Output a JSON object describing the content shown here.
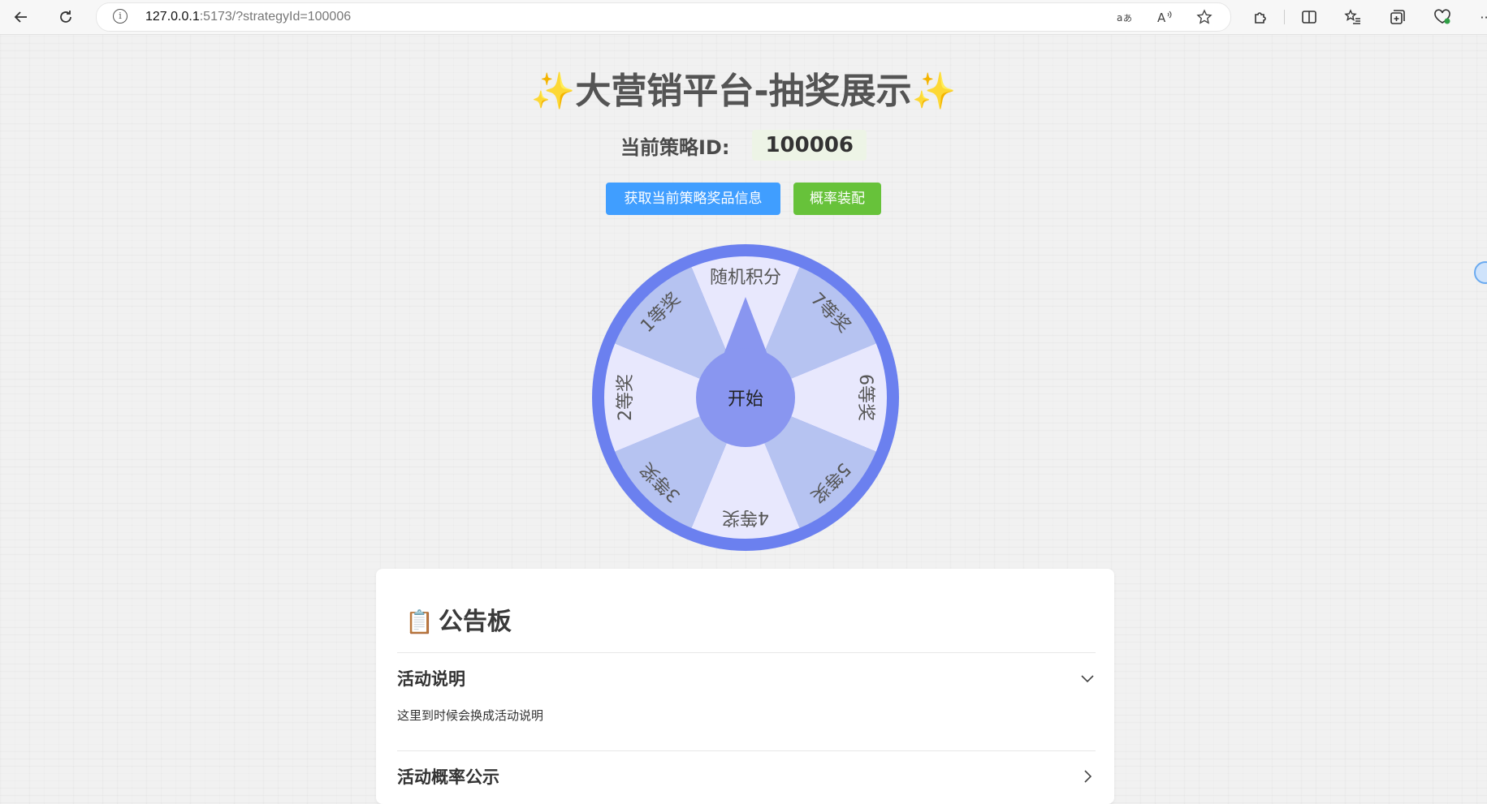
{
  "browser": {
    "url_host": "127.0.0.1",
    "url_rest": ":5173/?strategyId=100006"
  },
  "page": {
    "title": "✨大营销平台-抽奖展示✨",
    "strategy_label": "当前策略ID:",
    "strategy_id": "100006",
    "buttons": {
      "get_prize_info": "获取当前策略奖品信息",
      "probability_assemble": "概率装配"
    }
  },
  "wheel": {
    "center_label": "开始",
    "prizes": [
      "随机积分",
      "7等奖",
      "6等奖",
      "5等奖",
      "4等奖",
      "3等奖",
      "2等奖",
      "1等奖"
    ],
    "colors": {
      "ring": "#6b80ef",
      "sector_light": "#e8e8fd",
      "sector_dark": "#b6c3f1",
      "pointer": "#8996f0"
    }
  },
  "bulletin": {
    "title": "公告板",
    "items": [
      {
        "title": "活动说明",
        "content": "这里到时候会换成活动说明",
        "expanded": true
      },
      {
        "title": "活动概率公示",
        "expanded": false
      }
    ]
  }
}
